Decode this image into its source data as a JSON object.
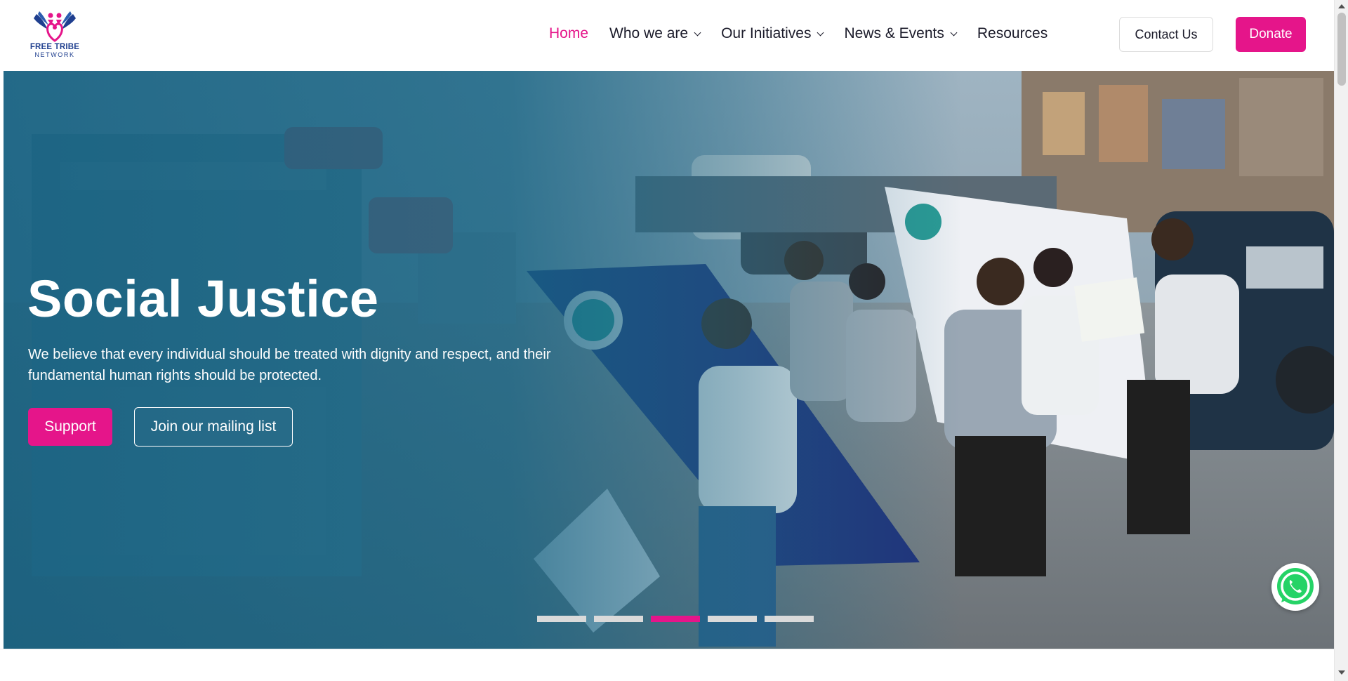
{
  "brand": {
    "name_line1": "FREE TRIBE",
    "name_line2": "NETWORK",
    "colors": {
      "primary_pink": "#e5158a",
      "navy": "#1f3f8f",
      "hero_overlay": "#125f80"
    }
  },
  "nav": {
    "items": [
      {
        "label": "Home",
        "active": true,
        "has_dropdown": false
      },
      {
        "label": "Who we are",
        "active": false,
        "has_dropdown": true
      },
      {
        "label": "Our Initiatives",
        "active": false,
        "has_dropdown": true
      },
      {
        "label": "News & Events",
        "active": false,
        "has_dropdown": true
      },
      {
        "label": "Resources",
        "active": false,
        "has_dropdown": false
      }
    ],
    "contact_label": "Contact Us",
    "donate_label": "Donate"
  },
  "hero": {
    "title": "Social Justice",
    "description": "We believe that every individual should be treated with dignity and respect, and their fundamental human rights should be protected.",
    "support_label": "Support",
    "mailing_label": "Join our mailing list",
    "slides_total": 5,
    "active_slide": 3
  },
  "icons": {
    "whatsapp": "whatsapp-icon",
    "logo": "heart-wings-logo",
    "dropdown": "chevron-down-icon"
  }
}
